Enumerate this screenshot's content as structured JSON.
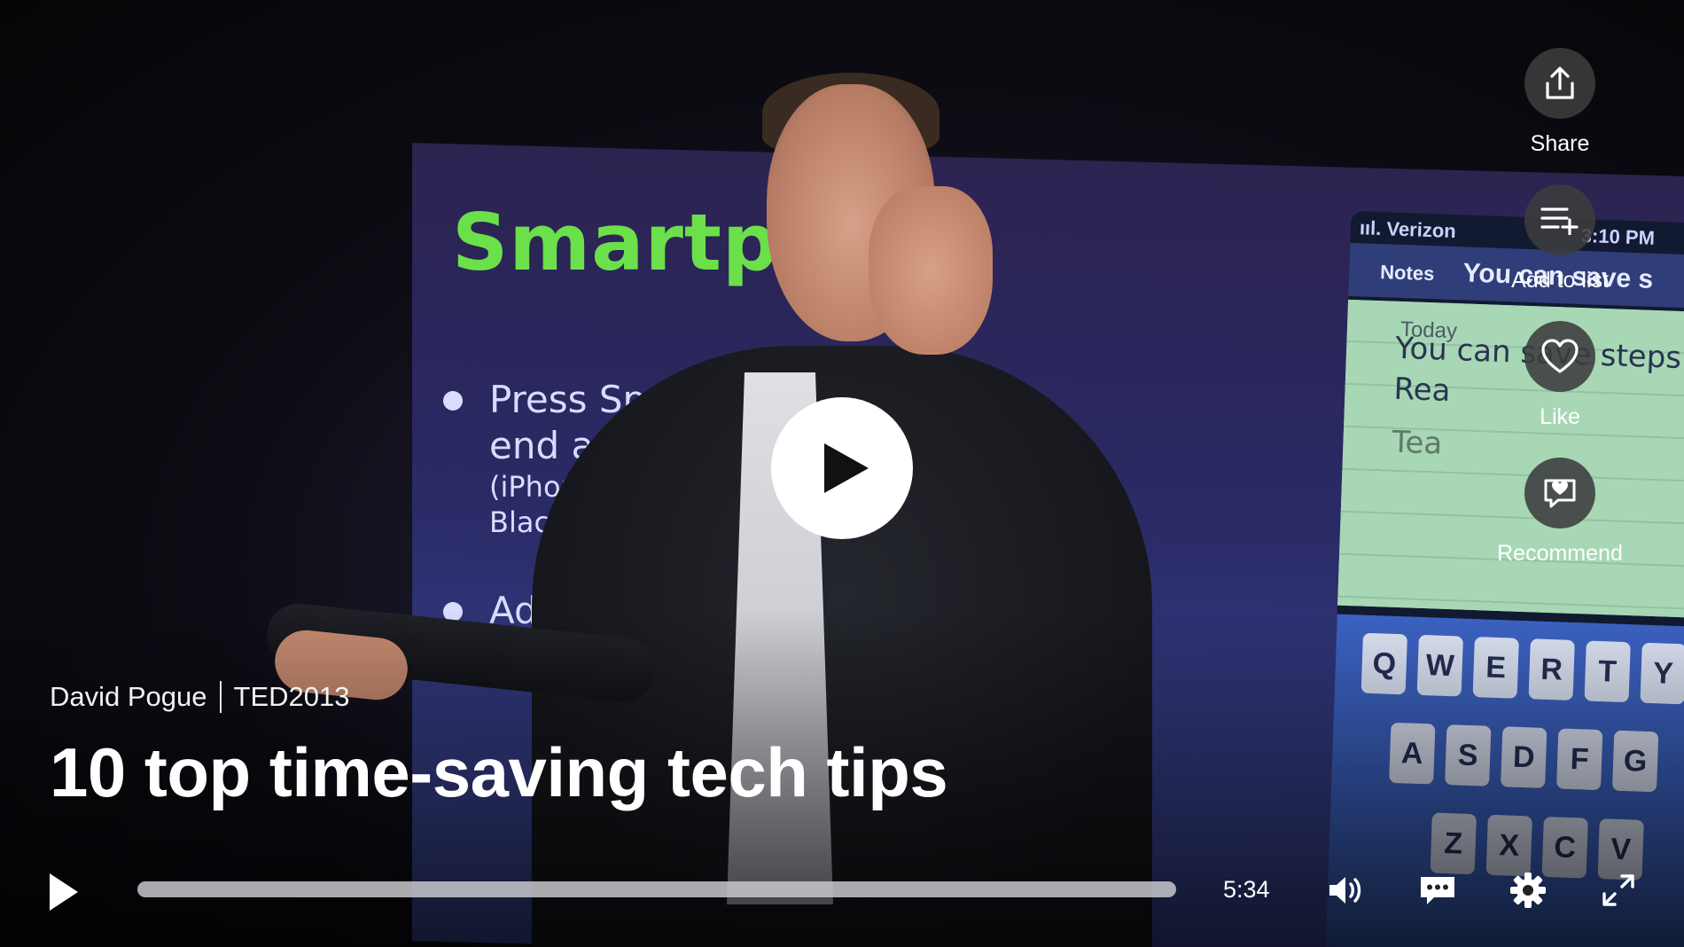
{
  "video": {
    "speaker": "David Pogue",
    "event": "TED2013",
    "title": "10 top time-saving tech tips"
  },
  "backdrop": {
    "slide_title": "Smartp    es",
    "bullet1_line1": "Press Space bar",
    "bullet1_line2": "end a senten",
    "bullet1_sub1": "(iPhone, Androi",
    "bullet1_sub2": "BlackBerry)",
    "bullet2": "Adds a p",
    "phone_status": "ııl. Verizon",
    "phone_time": "3:10 PM",
    "phone_notes": "Notes",
    "phone_header": "You can save s",
    "phone_today": "Today",
    "phone_line1": "You can save steps",
    "phone_line2": "Rea",
    "phone_suggest": "Tea",
    "keys_row1": [
      "Q",
      "W",
      "E",
      "R",
      "T",
      "Y"
    ],
    "keys_row2": [
      "A",
      "S",
      "D",
      "F",
      "G"
    ],
    "keys_row3": [
      "Z",
      "X",
      "C",
      "V"
    ]
  },
  "actions": {
    "share": "Share",
    "add_to_list": "Add to list",
    "like": "Like",
    "recommend": "Recommend"
  },
  "controls": {
    "duration": "5:34",
    "progress_fraction": 0.0
  },
  "icons": {
    "big_play": "play-icon",
    "share": "share-icon",
    "add_to_list": "playlist-add-icon",
    "like": "heart-icon",
    "recommend": "recommend-icon",
    "volume": "volume-icon",
    "captions": "captions-icon",
    "settings": "gear-icon",
    "fullscreen": "fullscreen-icon"
  },
  "colors": {
    "progress_track": "#c8c8cd",
    "accent": "#e62b1e"
  }
}
